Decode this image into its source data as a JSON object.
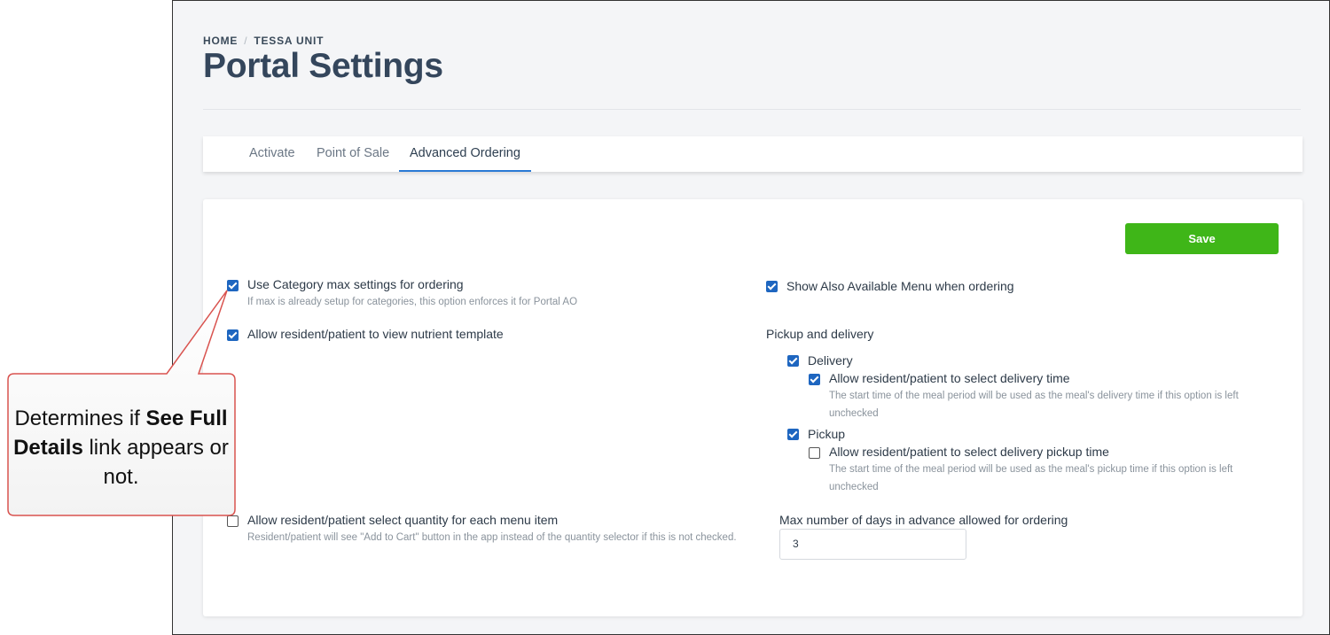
{
  "breadcrumb": {
    "home": "HOME",
    "separator": "/",
    "unit": "TESSA UNIT"
  },
  "page_title": "Portal Settings",
  "tabs": [
    {
      "label": "Activate",
      "active": false
    },
    {
      "label": "Point of Sale",
      "active": false
    },
    {
      "label": "Advanced Ordering",
      "active": true
    }
  ],
  "save_label": "Save",
  "left": {
    "category_max": {
      "label": "Use Category max settings for ordering",
      "hint": "If max is already setup for categories, this option enforces it for Portal AO",
      "checked": true
    },
    "nutrient": {
      "label": "Allow resident/patient to view nutrient template",
      "checked": true
    },
    "quantity": {
      "label": "Allow resident/patient select quantity for each menu item",
      "hint": "Resident/patient will see \"Add to Cart\" button in the app instead of the quantity selector if this is not checked.",
      "checked": false
    }
  },
  "right": {
    "also_available": {
      "label": "Show Also Available Menu when ordering",
      "checked": true
    },
    "pickup_delivery_label": "Pickup and delivery",
    "delivery": {
      "label": "Delivery",
      "checked": true
    },
    "delivery_time": {
      "label": "Allow resident/patient to select delivery time",
      "hint": "The start time of the meal period will be used as the meal's delivery time if this option is left unchecked",
      "checked": true
    },
    "pickup": {
      "label": "Pickup",
      "checked": true
    },
    "pickup_time": {
      "label": "Allow resident/patient to select delivery pickup time",
      "hint": "The start time of the meal period will be used as the meal's pickup time if this option is left unchecked",
      "checked": false
    },
    "max_days": {
      "label": "Max number of days in advance allowed for ordering",
      "value": "3"
    }
  },
  "callout": {
    "part1": "Determines if ",
    "bold": "See Full Details",
    "part2": " link appears or not."
  },
  "colors": {
    "accent": "#1e66c0",
    "save_button": "#3fb618",
    "title": "#34465c",
    "callout_border": "#d9534f"
  }
}
